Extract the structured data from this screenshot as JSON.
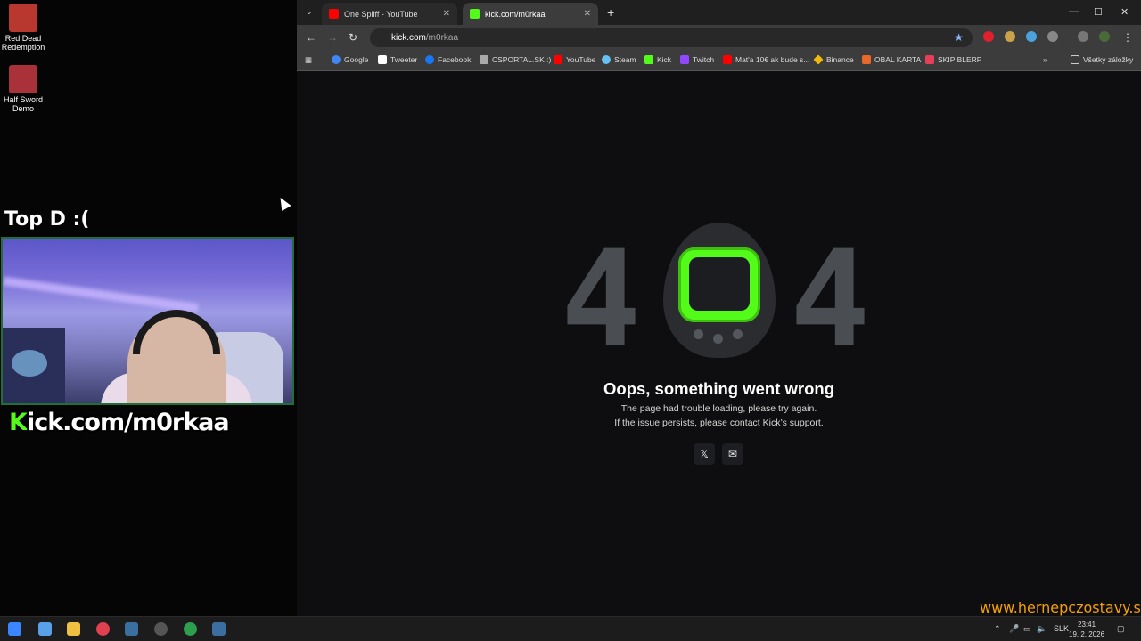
{
  "desktop": {
    "icons": [
      {
        "label": "Red Dead Redemption",
        "color": "#b8372f"
      },
      {
        "label": "Half Sword Demo",
        "color": "#a8313a"
      }
    ],
    "overlay_title": "Top D :(",
    "stream_logo": {
      "k": "K",
      "rest": "ick.com/m0rkaa"
    }
  },
  "browser": {
    "tabs": [
      {
        "title": "One Spliff - YouTube",
        "favicon": "youtube-icon",
        "active": false
      },
      {
        "title": "kick.com/m0rkaa",
        "favicon": "kick-icon",
        "active": true
      }
    ],
    "url": {
      "host": "kick.com",
      "path": "/m0rkaa"
    },
    "bookmarks": [
      {
        "label": "Google",
        "icon": "google-icon",
        "color": "#4285f4"
      },
      {
        "label": "Tweeter",
        "icon": "x-icon",
        "color": "#ffffff"
      },
      {
        "label": "Facebook",
        "icon": "facebook-icon",
        "color": "#1877f2"
      },
      {
        "label": "CSPORTAL.SK :)",
        "icon": "csportal-icon",
        "color": "#aaaaaa"
      },
      {
        "label": "YouTube",
        "icon": "youtube-icon",
        "color": "#ff0000"
      },
      {
        "label": "Steam",
        "icon": "steam-icon",
        "color": "#66c0f4"
      },
      {
        "label": "Kick",
        "icon": "kick-icon",
        "color": "#53fc18"
      },
      {
        "label": "Twitch",
        "icon": "twitch-icon",
        "color": "#9146ff"
      },
      {
        "label": "Mat'a 10€ ak bude s...",
        "icon": "youtube-icon",
        "color": "#ff0000"
      },
      {
        "label": "Binance",
        "icon": "binance-icon",
        "color": "#f0b90b"
      },
      {
        "label": "OBAL KARTA",
        "icon": "obal-icon",
        "color": "#e8672a"
      },
      {
        "label": "SKIP BLERP",
        "icon": "blerp-icon",
        "color": "#e83e5a"
      }
    ],
    "all_bookmarks": "Všetky záložky"
  },
  "error_page": {
    "code_left": "4",
    "code_right": "4",
    "title": "Oops, something went wrong",
    "line1": "The page had trouble loading, please try again.",
    "line2": "If the issue persists, please contact Kick’s support.",
    "accent": "#53fc18"
  },
  "taskbar": {
    "language": "SLK",
    "time": "23:41",
    "date": "19. 2. 2026"
  },
  "watermark": "www.hernepczostavy.sk"
}
